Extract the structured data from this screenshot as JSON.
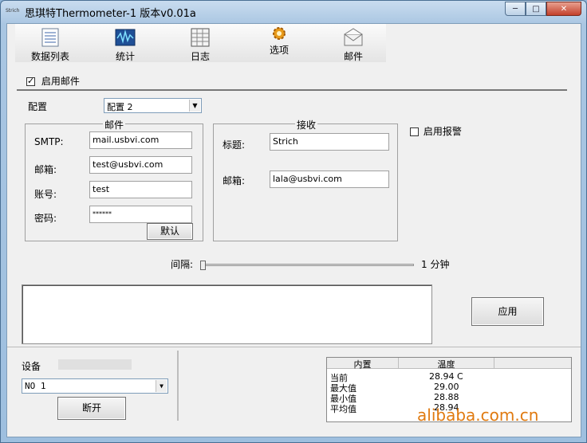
{
  "window": {
    "app_icon_text": "Strich",
    "title": "思琪特Thermometer-1 版本v0.01a",
    "minimize_symbol": "─",
    "maximize_symbol": "□",
    "close_symbol": "✕"
  },
  "toolbar": {
    "items": [
      {
        "label": "数据列表",
        "icon": "data-list-icon"
      },
      {
        "label": "统计",
        "icon": "statistics-icon"
      },
      {
        "label": "日志",
        "icon": "log-icon"
      },
      {
        "label": "选项",
        "icon": "options-gear-icon"
      },
      {
        "label": "邮件",
        "icon": "mail-envelope-icon"
      }
    ]
  },
  "email": {
    "enable_label": "启用邮件",
    "enabled": true,
    "config_label": "配置",
    "config_selected": "配置 2",
    "mail_group_title": "邮件",
    "smtp_label": "SMTP:",
    "smtp_value": "mail.usbvi.com",
    "mailbox_label": "邮箱:",
    "mailbox_value": "test@usbvi.com",
    "account_label": "账号:",
    "account_value": "test",
    "password_label": "密码:",
    "password_value": "******",
    "default_button": "默认",
    "receive_group_title": "接收",
    "subject_label": "标题:",
    "subject_value": "Strich",
    "recv_mailbox_label": "邮箱:",
    "recv_mailbox_value": "lala@usbvi.com",
    "alarm_label": "启用报警",
    "alarm_enabled": false,
    "interval_label": "间隔:",
    "interval_value": "1 分钟",
    "apply_button": "应用"
  },
  "device": {
    "label": "设备",
    "selected": "NO 1",
    "disconnect_button": "断开"
  },
  "stats_table": {
    "columns": [
      "内置",
      "温度"
    ],
    "rows": [
      {
        "name": "当前",
        "value": "28.94 C"
      },
      {
        "name": "最大值",
        "value": "29.00"
      },
      {
        "name": "最小值",
        "value": "28.88"
      },
      {
        "name": "平均值",
        "value": "28.94"
      }
    ]
  },
  "watermark": "alibaba.com.cn"
}
